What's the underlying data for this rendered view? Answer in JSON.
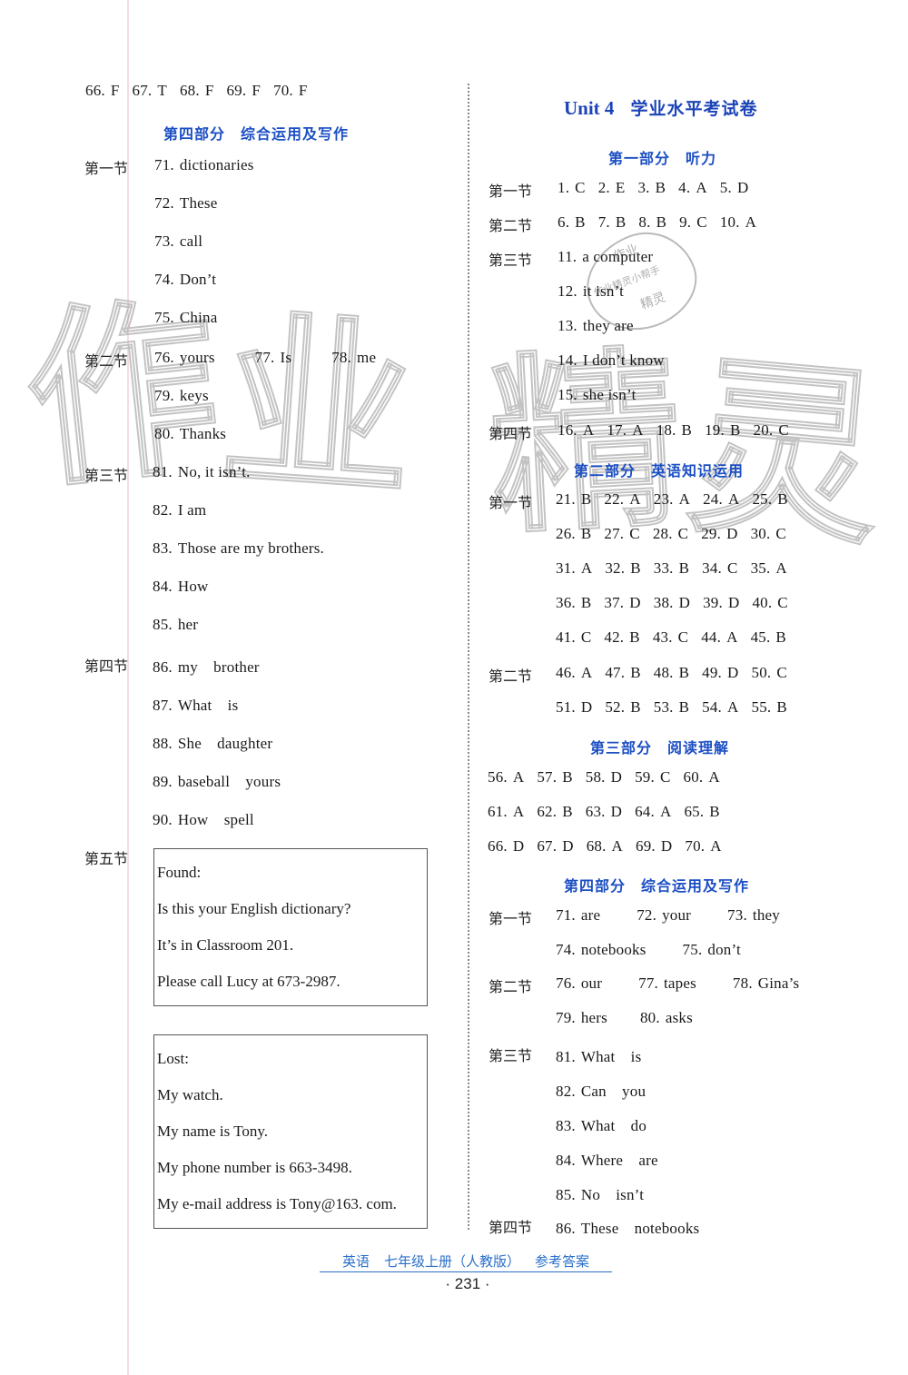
{
  "left": {
    "top_row": [
      {
        "n": "66.",
        "a": "F"
      },
      {
        "n": "67.",
        "a": "T"
      },
      {
        "n": "68.",
        "a": "F"
      },
      {
        "n": "69.",
        "a": "F"
      },
      {
        "n": "70.",
        "a": "F"
      }
    ],
    "part4_heading": "第四部分　综合运用及写作",
    "sec1_label": "第一节",
    "sec1": [
      {
        "n": "71.",
        "a": "dictionaries"
      },
      {
        "n": "72.",
        "a": "These"
      },
      {
        "n": "73.",
        "a": "call"
      },
      {
        "n": "74.",
        "a": "Don’t"
      },
      {
        "n": "75.",
        "a": "China"
      }
    ],
    "sec2_label": "第二节",
    "sec2_row1": [
      {
        "n": "76.",
        "a": "yours"
      },
      {
        "n": "77.",
        "a": "Is"
      },
      {
        "n": "78.",
        "a": "me"
      }
    ],
    "sec2": [
      {
        "n": "79.",
        "a": "keys"
      },
      {
        "n": "80.",
        "a": "Thanks"
      }
    ],
    "sec3_label": "第三节",
    "sec3": [
      {
        "n": "81.",
        "a": "No, it isn’t."
      },
      {
        "n": "82.",
        "a": "I am"
      },
      {
        "n": "83.",
        "a": "Those are my brothers."
      },
      {
        "n": "84.",
        "a": "How"
      },
      {
        "n": "85.",
        "a": "her"
      }
    ],
    "sec4_label": "第四节",
    "sec4": [
      {
        "n": "86.",
        "a": "my　brother"
      },
      {
        "n": "87.",
        "a": "What　is"
      },
      {
        "n": "88.",
        "a": "She　daughter"
      },
      {
        "n": "89.",
        "a": "baseball　yours"
      },
      {
        "n": "90.",
        "a": "How　spell"
      }
    ],
    "sec5_label": "第五节",
    "found_box": [
      "Found:",
      "Is this your English dictionary?",
      "It’s in Classroom 201.",
      "Please call Lucy at 673-2987."
    ],
    "lost_box": [
      "Lost:",
      "My watch.",
      "My name is Tony.",
      "My phone number is 663-3498.",
      "My e-mail address is Tony@163. com."
    ]
  },
  "right": {
    "title_en": "Unit 4",
    "title_cn": "学业水平考试卷",
    "part1_heading": "第一部分　听力",
    "p1_sec1_label": "第一节",
    "p1_sec1": [
      {
        "n": "1.",
        "a": "C"
      },
      {
        "n": "2.",
        "a": "E"
      },
      {
        "n": "3.",
        "a": "B"
      },
      {
        "n": "4.",
        "a": "A"
      },
      {
        "n": "5.",
        "a": "D"
      }
    ],
    "p1_sec2_label": "第二节",
    "p1_sec2": [
      {
        "n": "6.",
        "a": "B"
      },
      {
        "n": "7.",
        "a": "B"
      },
      {
        "n": "8.",
        "a": "B"
      },
      {
        "n": "9.",
        "a": "C"
      },
      {
        "n": "10.",
        "a": "A"
      }
    ],
    "p1_sec3_label": "第三节",
    "p1_sec3": [
      {
        "n": "11.",
        "a": "a computer"
      },
      {
        "n": "12.",
        "a": "it isn’t"
      },
      {
        "n": "13.",
        "a": "they are"
      },
      {
        "n": "14.",
        "a": "I don’t know"
      },
      {
        "n": "15.",
        "a": "she isn’t"
      }
    ],
    "p1_sec4_label": "第四节",
    "p1_sec4": [
      {
        "n": "16.",
        "a": "A"
      },
      {
        "n": "17.",
        "a": "A"
      },
      {
        "n": "18.",
        "a": "B"
      },
      {
        "n": "19.",
        "a": "B"
      },
      {
        "n": "20.",
        "a": "C"
      }
    ],
    "part2_heading": "第二部分　英语知识运用",
    "p2_sec1_label": "第一节",
    "p2_sec1_rows": [
      [
        {
          "n": "21.",
          "a": "B"
        },
        {
          "n": "22.",
          "a": "A"
        },
        {
          "n": "23.",
          "a": "A"
        },
        {
          "n": "24.",
          "a": "A"
        },
        {
          "n": "25.",
          "a": "B"
        }
      ],
      [
        {
          "n": "26.",
          "a": "B"
        },
        {
          "n": "27.",
          "a": "C"
        },
        {
          "n": "28.",
          "a": "C"
        },
        {
          "n": "29.",
          "a": "D"
        },
        {
          "n": "30.",
          "a": "C"
        }
      ],
      [
        {
          "n": "31.",
          "a": "A"
        },
        {
          "n": "32.",
          "a": "B"
        },
        {
          "n": "33.",
          "a": "B"
        },
        {
          "n": "34.",
          "a": "C"
        },
        {
          "n": "35.",
          "a": "A"
        }
      ],
      [
        {
          "n": "36.",
          "a": "B"
        },
        {
          "n": "37.",
          "a": "D"
        },
        {
          "n": "38.",
          "a": "D"
        },
        {
          "n": "39.",
          "a": "D"
        },
        {
          "n": "40.",
          "a": "C"
        }
      ],
      [
        {
          "n": "41.",
          "a": "C"
        },
        {
          "n": "42.",
          "a": "B"
        },
        {
          "n": "43.",
          "a": "C"
        },
        {
          "n": "44.",
          "a": "A"
        },
        {
          "n": "45.",
          "a": "B"
        }
      ]
    ],
    "p2_sec2_label": "第二节",
    "p2_sec2_rows": [
      [
        {
          "n": "46.",
          "a": "A"
        },
        {
          "n": "47.",
          "a": "B"
        },
        {
          "n": "48.",
          "a": "B"
        },
        {
          "n": "49.",
          "a": "D"
        },
        {
          "n": "50.",
          "a": "C"
        }
      ],
      [
        {
          "n": "51.",
          "a": "D"
        },
        {
          "n": "52.",
          "a": "B"
        },
        {
          "n": "53.",
          "a": "B"
        },
        {
          "n": "54.",
          "a": "A"
        },
        {
          "n": "55.",
          "a": "B"
        }
      ]
    ],
    "part3_heading": "第三部分　阅读理解",
    "p3_rows": [
      [
        {
          "n": "56.",
          "a": "A"
        },
        {
          "n": "57.",
          "a": "B"
        },
        {
          "n": "58.",
          "a": "D"
        },
        {
          "n": "59.",
          "a": "C"
        },
        {
          "n": "60.",
          "a": "A"
        }
      ],
      [
        {
          "n": "61.",
          "a": "A"
        },
        {
          "n": "62.",
          "a": "B"
        },
        {
          "n": "63.",
          "a": "D"
        },
        {
          "n": "64.",
          "a": "A"
        },
        {
          "n": "65.",
          "a": "B"
        }
      ],
      [
        {
          "n": "66.",
          "a": "D"
        },
        {
          "n": "67.",
          "a": "D"
        },
        {
          "n": "68.",
          "a": "A"
        },
        {
          "n": "69.",
          "a": "D"
        },
        {
          "n": "70.",
          "a": "A"
        }
      ]
    ],
    "part4_heading": "第四部分　综合运用及写作",
    "p4_sec1_label": "第一节",
    "p4_sec1_row1": [
      {
        "n": "71.",
        "a": "are"
      },
      {
        "n": "72.",
        "a": "your"
      },
      {
        "n": "73.",
        "a": "they"
      }
    ],
    "p4_sec1_row2": [
      {
        "n": "74.",
        "a": "notebooks"
      },
      {
        "n": "75.",
        "a": "don’t"
      }
    ],
    "p4_sec2_label": "第二节",
    "p4_sec2_row1": [
      {
        "n": "76.",
        "a": "our"
      },
      {
        "n": "77.",
        "a": "tapes"
      },
      {
        "n": "78.",
        "a": "Gina’s"
      }
    ],
    "p4_sec2_row2": [
      {
        "n": "79.",
        "a": "hers"
      },
      {
        "n": "80.",
        "a": "asks"
      }
    ],
    "p4_sec3_label": "第三节",
    "p4_sec3": [
      {
        "n": "81.",
        "a": "What　is"
      },
      {
        "n": "82.",
        "a": "Can　you"
      },
      {
        "n": "83.",
        "a": "What　do"
      },
      {
        "n": "84.",
        "a": "Where　are"
      },
      {
        "n": "85.",
        "a": "No　isn’t"
      }
    ],
    "p4_sec4_label": "第四节",
    "p4_sec4": [
      {
        "n": "86.",
        "a": "These　notebooks"
      }
    ]
  },
  "watermark": {
    "chars": [
      "作",
      "业",
      "精",
      "灵"
    ],
    "stamp_lines": [
      "作业",
      "作业精灵小帮手",
      "精灵"
    ]
  },
  "footer": {
    "subject": "英语",
    "book": "七年级上册（人教版）",
    "label": "参考答案",
    "page_number": "· 231 ·"
  },
  "colors": {
    "heading": "#1c4fc4",
    "footer": "#2a6fc9"
  }
}
